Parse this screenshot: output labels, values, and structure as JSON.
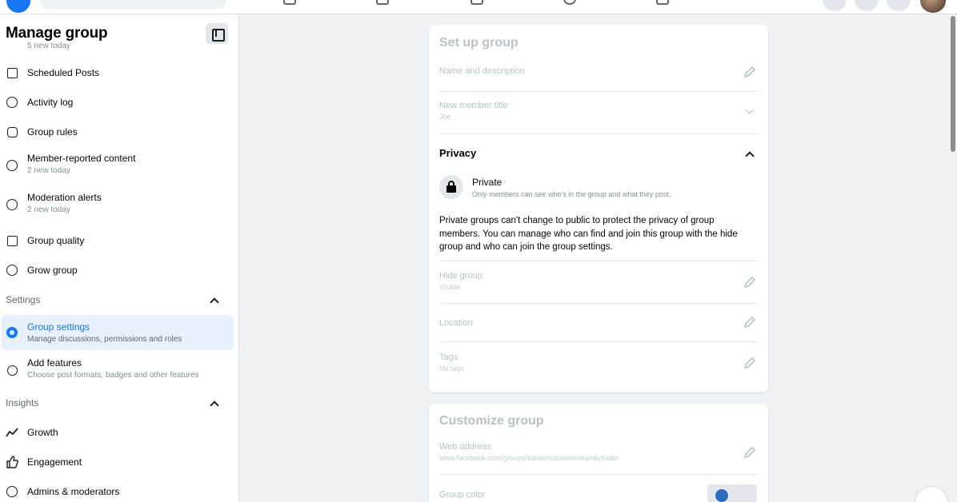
{
  "topbar": {
    "icons": [
      "facebook-logo",
      "search",
      "pages-icon",
      "video-icon",
      "marketplace-icon",
      "groups-icon",
      "gaming-icon",
      "menu-grid-icon",
      "messenger-icon",
      "notifications-icon",
      "avatar"
    ]
  },
  "sidebar": {
    "title": "Manage group",
    "cut_off_text": "5 new today",
    "items": [
      {
        "label": "Scheduled Posts",
        "sub": "",
        "icon": "calendar-icon"
      },
      {
        "label": "Activity log",
        "sub": "",
        "icon": "clock-icon"
      },
      {
        "label": "Group rules",
        "sub": "",
        "icon": "rules-icon"
      },
      {
        "label": "Member-reported content",
        "sub": "2 new today",
        "icon": "report-icon"
      },
      {
        "label": "Moderation alerts",
        "sub": "2 new today",
        "icon": "alert-icon"
      },
      {
        "label": "Group quality",
        "sub": "",
        "icon": "quality-icon"
      },
      {
        "label": "Grow group",
        "sub": "",
        "icon": "grow-icon"
      }
    ],
    "settings": {
      "header": "Settings",
      "items": [
        {
          "label": "Group settings",
          "sub": "Manage discussions, permissions and roles",
          "icon": "gear-icon",
          "active": true
        },
        {
          "label": "Add features",
          "sub": "Choose post formats, badges and other features",
          "icon": "features-icon"
        }
      ]
    },
    "insights": {
      "header": "Insights",
      "items": [
        {
          "label": "Growth",
          "icon": "growth-icon"
        },
        {
          "label": "Engagement",
          "icon": "thumbs-up-icon"
        },
        {
          "label": "Admins & moderators",
          "icon": "admins-icon"
        }
      ]
    }
  },
  "setup_card": {
    "title": "Set up group",
    "name_desc": "Name and description",
    "new_member_label": "New member title",
    "new_member_value": "Joe",
    "privacy_title": "Privacy",
    "privacy_name": "Private",
    "privacy_desc": "Only members can see who's in the group and what they post.",
    "privacy_para": "Private groups can't change to public to protect the privacy of group members. You can manage who can find and join this group with the hide group and who can join the group settings.",
    "hide_label": "Hide group",
    "hide_value": "Visible",
    "location_label": "Location",
    "tags_label": "Tags",
    "tags_value": "No tags"
  },
  "customize_card": {
    "title": "Customize group",
    "web_label": "Web address",
    "web_value": "www.facebook.com/groups/theworldtravelersfamily/hotel",
    "color_label": "Group color"
  },
  "colors": {
    "accent": "#1877f2",
    "active_bg": "#e7f0fd",
    "muted": "#bcc0c4"
  }
}
